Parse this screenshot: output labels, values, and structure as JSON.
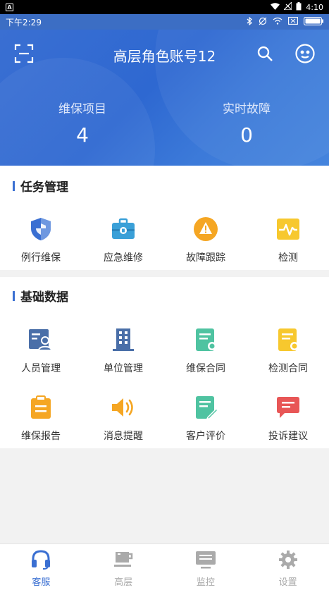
{
  "system_bar": {
    "time": "4:10"
  },
  "status_bar": {
    "time": "下午2:29"
  },
  "header": {
    "title": "高层角色账号12",
    "stats": [
      {
        "label": "维保项目",
        "value": "4"
      },
      {
        "label": "实时故障",
        "value": "0"
      }
    ]
  },
  "task_section": {
    "title": "任务管理",
    "items": [
      {
        "label": "例行维保",
        "icon": "shield-icon"
      },
      {
        "label": "应急维修",
        "icon": "toolbox-icon"
      },
      {
        "label": "故障跟踪",
        "icon": "warning-icon"
      },
      {
        "label": "检测",
        "icon": "pulse-icon"
      }
    ]
  },
  "data_section": {
    "title": "基础数据",
    "items": [
      {
        "label": "人员管理",
        "icon": "id-card-icon"
      },
      {
        "label": "单位管理",
        "icon": "building-icon"
      },
      {
        "label": "维保合同",
        "icon": "contract-icon"
      },
      {
        "label": "检测合同",
        "icon": "test-contract-icon"
      },
      {
        "label": "维保报告",
        "icon": "clipboard-icon"
      },
      {
        "label": "消息提醒",
        "icon": "speaker-icon"
      },
      {
        "label": "客户评价",
        "icon": "edit-doc-icon"
      },
      {
        "label": "投诉建议",
        "icon": "chat-icon"
      }
    ]
  },
  "tabs": [
    {
      "label": "客服",
      "icon": "headset-icon",
      "active": true
    },
    {
      "label": "高层",
      "icon": "coffee-icon",
      "active": false
    },
    {
      "label": "监控",
      "icon": "monitor-icon",
      "active": false
    },
    {
      "label": "设置",
      "icon": "gear-icon",
      "active": false
    }
  ],
  "colors": {
    "primary": "#3a6fd2",
    "orange": "#f5a623",
    "teal": "#4fc3a1",
    "yellow": "#f7c82e",
    "red": "#e85656",
    "inactive": "#aaaaaa"
  }
}
